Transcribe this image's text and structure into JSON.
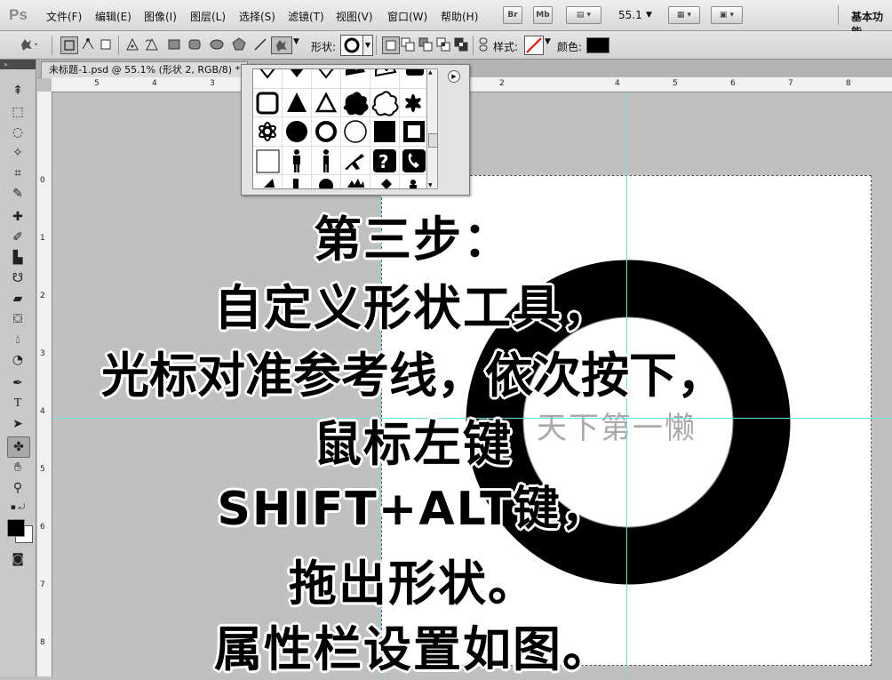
{
  "app": {
    "logo": "Ps"
  },
  "menu": [
    "文件(F)",
    "编辑(E)",
    "图像(I)",
    "图层(L)",
    "选择(S)",
    "滤镜(T)",
    "视图(V)",
    "窗口(W)",
    "帮助(H)"
  ],
  "menubar_right": {
    "br": "Br",
    "mb": "Mb",
    "zoom": "55.1",
    "workspace": "基本功能"
  },
  "options": {
    "shape_label": "形状:",
    "style_label": "样式:",
    "color_label": "颜色:",
    "color": "#000000"
  },
  "document_tab": "未标题-1.psd @ 55.1% (形状 2, RGB/8) *",
  "ruler_h": [
    "5",
    "4",
    "3",
    "2",
    "4",
    "5",
    "6",
    "7",
    "8"
  ],
  "ruler_v": [
    "0",
    "1",
    "2",
    "3",
    "4",
    "5",
    "6",
    "7",
    "8"
  ],
  "canvas": {
    "watermark": "天下第一懒"
  },
  "overlay_text": [
    "第三步：",
    "自定义形状工具，",
    "光标对准参考线，依次按下，",
    "鼠标左键",
    "SHIFT+ALT键，",
    "拖出形状。",
    "属性栏设置如图。"
  ],
  "colors": {
    "guide": "#6ce0e0",
    "foreground": "#000000",
    "background": "#ffffff"
  }
}
